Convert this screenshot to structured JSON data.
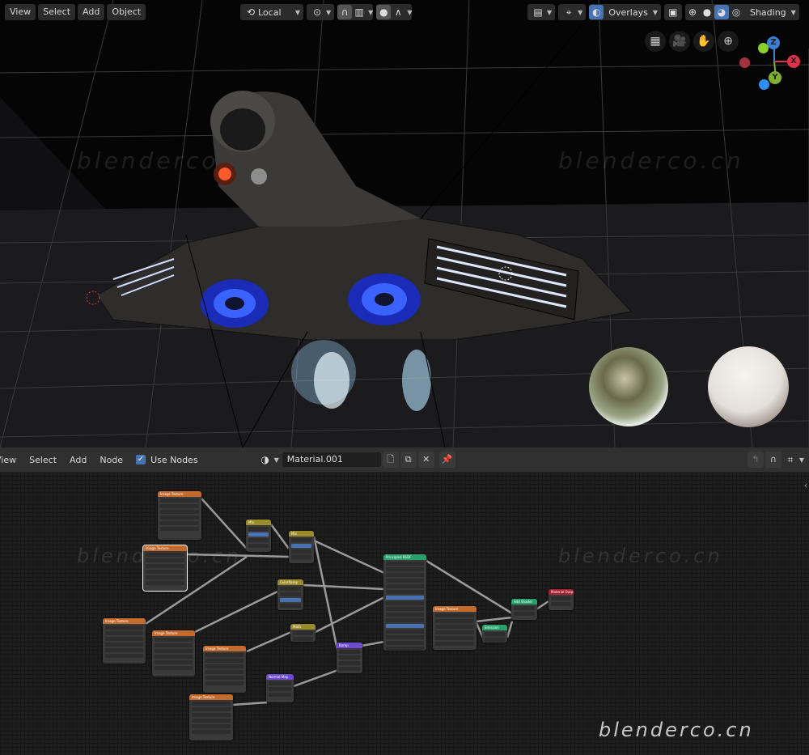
{
  "viewport": {
    "header": {
      "menus": [
        "View",
        "Select",
        "Add",
        "Object"
      ],
      "transform_orientation": "Local",
      "overlays_label": "Overlays",
      "shading_label": "Shading",
      "icons": {
        "orientation": "transform-orientation-icon",
        "pivot": "pivot-point-icon",
        "snap": "snap-magnet-icon",
        "snap_target": "snap-increment-icon",
        "proportional": "proportional-edit-icon",
        "falloff": "falloff-curve-icon",
        "view_object_types": "object-types-icon",
        "gizmo": "gizmo-icon",
        "overlays": "overlays-icon",
        "xray": "xray-icon",
        "shading_modes": [
          "wireframe-icon",
          "solid-icon",
          "material-preview-icon",
          "rendered-icon"
        ]
      }
    },
    "nav_gizmo": {
      "buttons": [
        "toggle-grid-icon",
        "camera-view-icon",
        "pan-hand-icon",
        "zoom-icon"
      ],
      "axes": {
        "x": "X",
        "y": "Y",
        "z": "Z"
      },
      "colors": {
        "x": "#e0304a",
        "y": "#7fb02e",
        "z": "#3b7fd4",
        "neg_x": "#a3323f",
        "neg_y": "#8bd12b",
        "neg_z": "#2e8ef2"
      }
    },
    "watermarks": [
      "blenderco",
      "blenderco.cn"
    ]
  },
  "node_editor": {
    "header": {
      "menus": [
        "View",
        "Select",
        "Add",
        "Node"
      ],
      "use_nodes_label": "Use Nodes",
      "use_nodes_checked": true,
      "material_name": "Material.001",
      "icons": [
        "material-browse-icon",
        "new-material-icon",
        "duplicate-icon",
        "unlink-icon",
        "pin-icon",
        "parent-node-icon",
        "snap-icon",
        "node-snap-grid-icon"
      ]
    },
    "watermarks": [
      "blenderco.cn",
      "blenderco.cn"
    ],
    "corner_watermark": "blenderco.cn",
    "nodes": [
      {
        "type": "tex",
        "title": "Image Texture",
        "selected": false
      },
      {
        "type": "tex",
        "title": "Image Texture",
        "selected": true
      },
      {
        "type": "conv",
        "title": "Mix"
      },
      {
        "type": "conv",
        "title": "Mix"
      },
      {
        "type": "conv",
        "title": "ColorRamp"
      },
      {
        "type": "tex",
        "title": "Image Texture"
      },
      {
        "type": "tex",
        "title": "Image Texture"
      },
      {
        "type": "conv",
        "title": "Math"
      },
      {
        "type": "tex",
        "title": "Image Texture"
      },
      {
        "type": "vec",
        "title": "Bump"
      },
      {
        "type": "vec",
        "title": "Normal Map"
      },
      {
        "type": "tex",
        "title": "Image Texture"
      },
      {
        "type": "shader",
        "title": "Principled BSDF"
      },
      {
        "type": "tex",
        "title": "Image Texture"
      },
      {
        "type": "shader",
        "title": "Emission"
      },
      {
        "type": "shader",
        "title": "Add Shader"
      },
      {
        "type": "out",
        "title": "Material Output"
      }
    ]
  },
  "colors": {
    "accent": "#4772b3",
    "header_bg": "#303030",
    "node_texture": "#c46a2b",
    "node_converter": "#9a8c2a",
    "node_shader": "#27a06a",
    "node_vector": "#6c4bd0",
    "node_output": "#a52232"
  }
}
